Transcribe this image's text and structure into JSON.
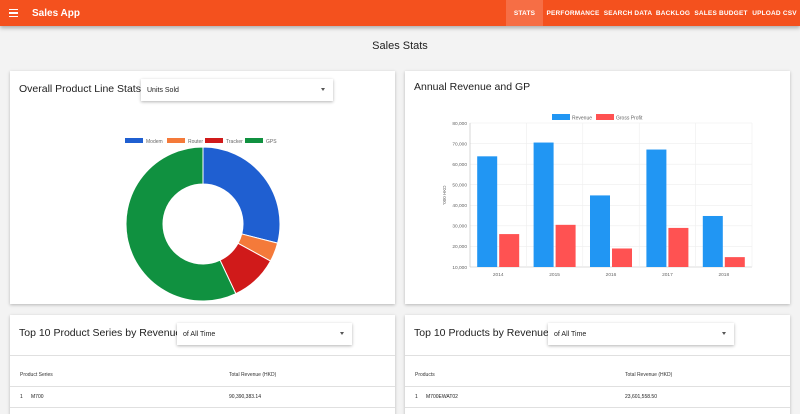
{
  "app": {
    "title": "Sales App"
  },
  "nav": [
    {
      "label": "STATS",
      "active": true
    },
    {
      "label": "PERFORMANCE",
      "active": false
    },
    {
      "label": "SEARCH DATA",
      "active": false
    },
    {
      "label": "BACKLOG",
      "active": false
    },
    {
      "label": "SALES BUDGET",
      "active": false
    },
    {
      "label": "UPLOAD CSV",
      "active": false
    }
  ],
  "page": {
    "title": "Sales Stats"
  },
  "product_line": {
    "title": "Overall Product Line Stats",
    "metric": "Units Sold"
  },
  "revenue_gp": {
    "title": "Annual Revenue and GP"
  },
  "top_series": {
    "title": "Top 10 Product Series by Revenue",
    "period": "of All Time",
    "columns": [
      "Product Series",
      "Total Revenue (HKD)"
    ],
    "rows": [
      {
        "rank": "1",
        "name": "M700",
        "value": "90,390,383.14"
      }
    ]
  },
  "top_products": {
    "title": "Top 10 Products by Revenue",
    "period": "of All Time",
    "columns": [
      "Products",
      "Total Revenue (HKD)"
    ],
    "rows": [
      {
        "rank": "1",
        "name": "M700EWAT02",
        "value": "23,601,558.50"
      }
    ]
  },
  "chart_data": [
    {
      "type": "pie",
      "donut": true,
      "labels": [
        "Modem",
        "Router",
        "Tracker",
        "GPS"
      ],
      "values": [
        29,
        4,
        10,
        57
      ],
      "colors": [
        "#1f5fd1",
        "#f47a3a",
        "#d01a1a",
        "#109140"
      ],
      "legend": "top"
    },
    {
      "type": "bar",
      "categories": [
        "2014",
        "2015",
        "2016",
        "2017",
        "2018"
      ],
      "series": [
        {
          "name": "Revenue",
          "values": [
            63.8,
            70.5,
            44.8,
            67.1,
            34.8
          ],
          "color": "#2196f3"
        },
        {
          "name": "Gross Profit",
          "values": [
            26,
            30.5,
            19,
            29,
            14.8
          ],
          "color": "#ff5252"
        }
      ],
      "ylabel": "'000 HKD",
      "yticks": [
        "10,000",
        "20,000",
        "30,000",
        "40,000",
        "50,000",
        "60,000",
        "70,000",
        "80,000"
      ],
      "ylim": [
        10,
        80
      ],
      "legend": "top",
      "grid": true
    }
  ]
}
